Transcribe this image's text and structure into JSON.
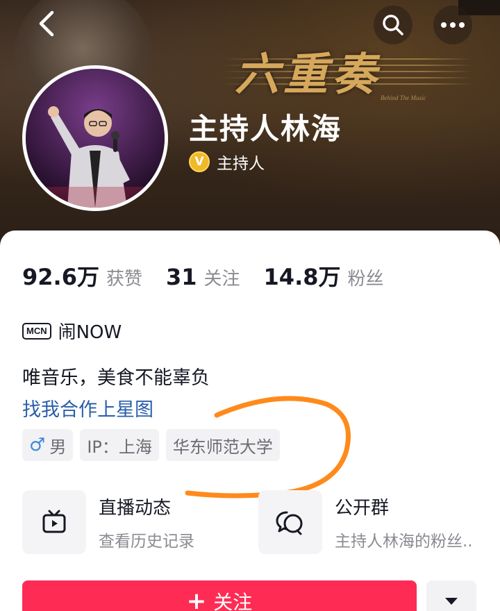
{
  "header": {
    "banner_title": "六重奏",
    "banner_subtitle": "Behind The Music",
    "back_icon": "chevron-left-icon",
    "search_icon": "search-icon",
    "more_icon": "more-horizontal-icon"
  },
  "profile": {
    "name": "主持人林海",
    "verify_badge": "V",
    "verify_label": "主持人"
  },
  "stats": [
    {
      "num": "92.6万",
      "label": "获赞"
    },
    {
      "num": "31",
      "label": "关注"
    },
    {
      "num": "14.8万",
      "label": "粉丝"
    }
  ],
  "mcn": {
    "icon_text": "MCN",
    "org": "闹NOW"
  },
  "bio": {
    "text": "唯音乐，美食不能辜负",
    "link": "找我合作上星图"
  },
  "tags": {
    "gender_icon": "♂",
    "gender": "男",
    "ip": "IP：上海",
    "school": "华东师范大学"
  },
  "features": {
    "live": {
      "title": "直播动态",
      "subtitle": "查看历史记录",
      "icon": "tv-icon"
    },
    "group": {
      "title": "公开群",
      "subtitle": "主持人林海的粉丝..",
      "icon": "chat-bubbles-icon"
    }
  },
  "actions": {
    "follow_plus": "+",
    "follow_label": "关注",
    "more_icon": "caret-down-icon"
  },
  "colors": {
    "follow": "#fe2c55",
    "link": "#2a5eab",
    "marker": "#ff8a1c",
    "badge": "#f0b92a"
  }
}
